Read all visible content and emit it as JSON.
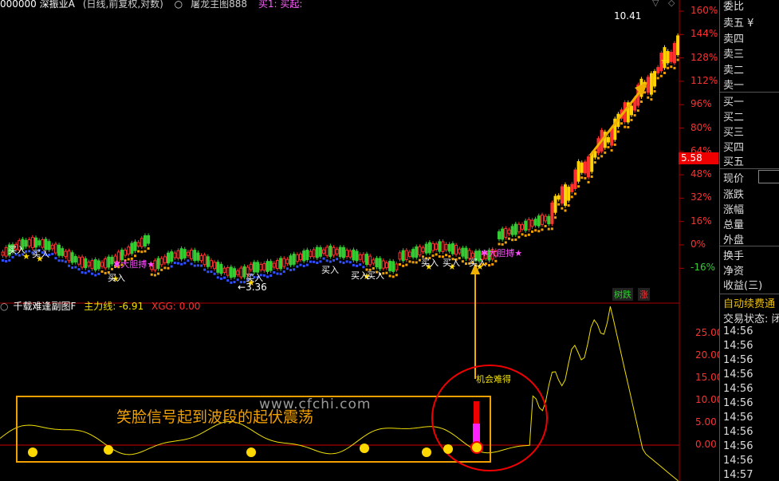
{
  "header": {
    "code_name": "000000 深振业A",
    "adjust": "(日线,前复权,对数)",
    "indicator": "屠龙主图888",
    "indicator_params": "买1: 买起:"
  },
  "main_axis": {
    "percent_ticks": [
      "160%",
      "144%",
      "128%",
      "112%",
      "96%",
      "80%",
      "64%",
      "48%",
      "32%",
      "16%",
      "0%",
      "-16%"
    ],
    "current_price": "5.58"
  },
  "annotations": {
    "high_price": "10.41",
    "low_price": "3.36",
    "buy_label": "买入",
    "bold_buy_label": "大胆搏",
    "buy_labels": [
      "买入",
      "买入",
      "买入",
      "买入",
      "买入",
      "买入",
      "买入",
      "买入",
      "买入",
      "买入"
    ],
    "tag_down": "树跌",
    "tag_up": "涨"
  },
  "sub_chart": {
    "title": "千载难逢副图F",
    "main_line_label": "主力线: -6.91",
    "xgg_label": "XGG: 0.00",
    "axis_ticks": [
      "25.00",
      "20.00",
      "15.00",
      "10.00",
      "5.00",
      "0.00"
    ],
    "chance_label": "机会难得",
    "annotation": "笑脸信号起到波段的起伏震荡",
    "watermark": "www.cfchi.com"
  },
  "right_panel": {
    "ratio_label": "委比",
    "sell": [
      "卖五 ¥",
      "卖四",
      "卖三",
      "卖二",
      "卖一"
    ],
    "buy": [
      "买一",
      "买二",
      "买三",
      "买四",
      "买五"
    ],
    "stats": [
      "现价",
      "涨跌",
      "涨幅",
      "总量",
      "外盘"
    ],
    "stats2": [
      "换手",
      "净资",
      "收益(三)"
    ],
    "auto_renew": "自动续费通",
    "trade_status": "交易状态: 闭",
    "times": [
      "14:56",
      "14:56",
      "14:56",
      "14:56",
      "14:56",
      "14:56",
      "14:56",
      "14:56",
      "14:56",
      "14:56",
      "14:57"
    ]
  },
  "colors": {
    "up": "#ff3030",
    "down": "#33cc33",
    "bull_fill": "#ffd200",
    "accent": "#f0a000",
    "ma_dot": "#3050ff"
  }
}
